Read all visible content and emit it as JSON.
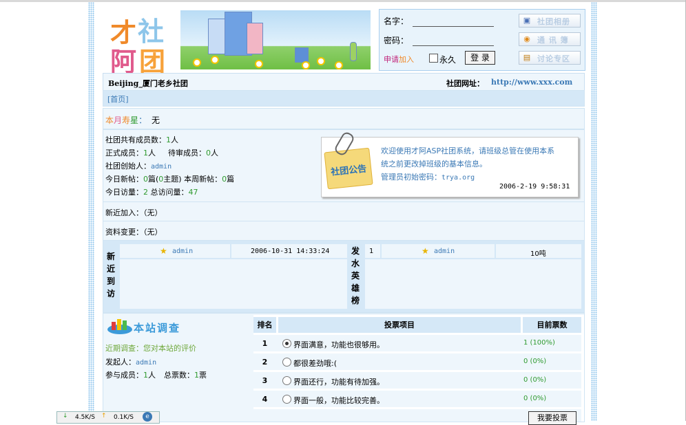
{
  "logo": {
    "chars": [
      "才",
      "社",
      "阿",
      "团"
    ]
  },
  "login": {
    "name_label": "名字：",
    "password_label": "密码：",
    "apply_prefix": "申请",
    "apply_suffix": "加入",
    "remember_label": "永久",
    "login_button": "登 录"
  },
  "side_buttons": [
    {
      "icon": "photo-album-icon",
      "glyph": "▣",
      "label": "社团相册"
    },
    {
      "icon": "contacts-icon",
      "glyph": "◉",
      "label": "通 讯 簿"
    },
    {
      "icon": "chat-bubble-icon",
      "glyph": "▤",
      "label": "讨论专区"
    }
  ],
  "club": {
    "name": "Beijing_厦门老乡社团",
    "url_label": "社团网址：",
    "url": "http://www.xxx.com"
  },
  "breadcrumb": {
    "home": "[首页]"
  },
  "birthday": {
    "label_a": "本",
    "label_b": "月",
    "label_c": "寿",
    "label_d": "星",
    "label_e": "：",
    "value": "无"
  },
  "stats": {
    "total_label": "社团共有成员数：",
    "total": "1",
    "unit_person": "人",
    "official_label": "正式成员：",
    "official": "1",
    "pending_label": "待审成员：",
    "pending": "0",
    "founder_label": "社团创始人：",
    "founder": "admin",
    "today_posts_label": "今日新帖：",
    "today_posts": "0",
    "unit_post": "篇",
    "topic_open": "(",
    "topics": "0",
    "topic_close": "主题)",
    "week_label": " 本周新帖：",
    "week_posts": "0",
    "today_visits_label": "今日访量：",
    "today_visits": "2",
    "total_visits_label": " 总访问量：",
    "total_visits": "47"
  },
  "notice": {
    "badge": "社团公告",
    "line1": "欢迎使用才阿ASP社团系统，请班级总管在使用本系",
    "line2": "统之前更改掉班级的基本信息。",
    "line3_label": "管理员初始密码：",
    "line3_value": "trya.org",
    "time": "2006-2-19 9:58:31"
  },
  "recent_join": {
    "label": "新近加入：",
    "value": "（无）"
  },
  "profile_change": {
    "label": "资料变更：",
    "value": "（无）"
  },
  "visitors": {
    "title_chars": [
      "新",
      "近",
      "到",
      "访"
    ],
    "user": "admin",
    "time": "2006-10-31 14:33:24"
  },
  "poster_rank": {
    "title_chars": [
      "发",
      "水",
      "英",
      "雄",
      "榜"
    ],
    "rank": "1",
    "user": "admin",
    "amount": "10吨"
  },
  "survey": {
    "title": "本站调查",
    "recent_label": "近期调查：",
    "recent_value": "您对本站的评价",
    "creator_label": "发起人：",
    "creator": "admin",
    "members_label": "参与成员：",
    "members": "1",
    "members_unit": "人",
    "votes_label": "总票数：",
    "votes": "1",
    "votes_unit": "票",
    "headers": {
      "rank": "排名",
      "item": "投票项目",
      "count": "目前票数"
    },
    "options": [
      {
        "rank": "1",
        "text": "界面满意，功能也很够用。",
        "count": "1 (100%)",
        "checked": true
      },
      {
        "rank": "2",
        "text": "都很差劲哦:(",
        "count": "0 (0%)",
        "checked": false
      },
      {
        "rank": "3",
        "text": "界面还行，功能有待加强。",
        "count": "0 (0%)",
        "checked": false
      },
      {
        "rank": "4",
        "text": "界面一般，功能比较完善。",
        "count": "0 (0%)",
        "checked": false
      }
    ],
    "vote_button": "我要投票"
  },
  "statusbar": {
    "down": "4.5K/S",
    "up": "0.1K/S"
  },
  "colors": {
    "accent_blue": "#3b79b5",
    "number_green": "#2f9a2f",
    "panel_blue": "#d5e8f7"
  }
}
